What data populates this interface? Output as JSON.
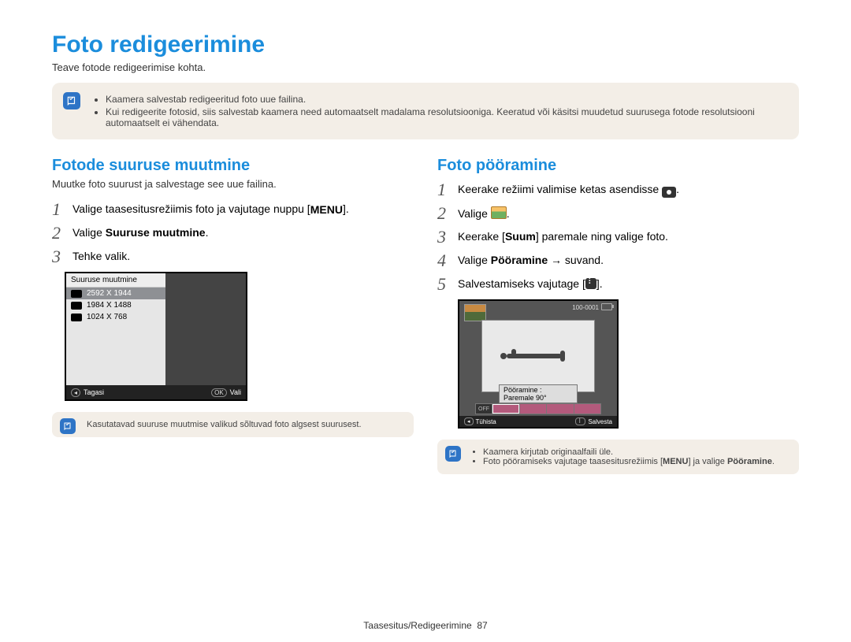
{
  "title": "Foto redigeerimine",
  "subtitle": "Teave fotode redigeerimise kohta.",
  "top_note": [
    "Kaamera salvestab redigeeritud foto uue failina.",
    "Kui redigeerite fotosid, siis salvestab kaamera need automaatselt madalama resolutsiooniga. Keeratud või käsitsi muudetud suurusega fotode resolutsiooni automaatselt ei vähendata."
  ],
  "left": {
    "heading": "Fotode suuruse muutmine",
    "desc": "Muutke foto suurust ja salvestage see uue failina.",
    "steps": {
      "s1_pre": "Valige taasesitusrežiimis foto ja vajutage nuppu [",
      "s1_token": "MENU",
      "s1_post": "].",
      "s2_pre": "Valige ",
      "s2_bold": "Suuruse muutmine",
      "s2_post": ".",
      "s3": "Tehke valik."
    },
    "resize_screen": {
      "header": "Suuruse muutmine",
      "rows": [
        "2592 X 1944",
        "1984 X 1488",
        "1024 X 768"
      ],
      "back": "Tagasi",
      "ok": "OK",
      "select": "Vali"
    },
    "small_note": "Kasutatavad suuruse muutmise valikud sõltuvad foto algsest suurusest."
  },
  "right": {
    "heading": "Foto pööramine",
    "steps": {
      "s1_pre": "Keerake režiimi valimise ketas asendisse ",
      "s1_post": ".",
      "s2": "Valige ",
      "s2_post": ".",
      "s3_pre": "Keerake [",
      "s3_bold": "Suum",
      "s3_post": "] paremale ning valige foto.",
      "s4_pre": "Valige ",
      "s4_bold": "Pööramine",
      "s4_mid": " → suvand.",
      "s5_pre": "Salvestamiseks vajutage [",
      "s5_post": "]."
    },
    "rotate_screen": {
      "info": "100-0001",
      "label": "Pööramine : Paremale 90°",
      "off": "OFF",
      "cancel": "Tühista",
      "save": "Salvesta"
    },
    "small_note": [
      "Kaamera kirjutab originaalfaili üle.",
      "Foto pööramiseks vajutage taasesitusrežiimis [",
      "MENU",
      "] ja valige ",
      "Pööramine",
      "."
    ]
  },
  "footer": {
    "text": "Taasesitus/Redigeerimine",
    "page": "87"
  }
}
